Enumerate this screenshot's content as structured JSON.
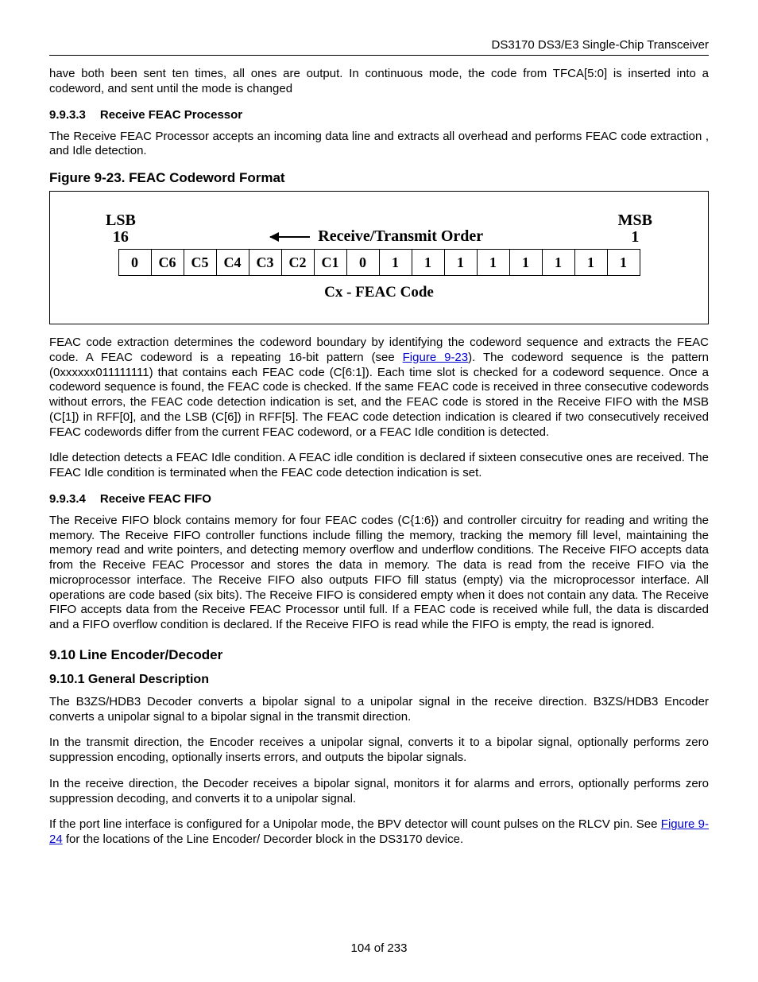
{
  "header": {
    "title": "DS3170 DS3/E3 Single-Chip Transceiver"
  },
  "intro_para": "have both been sent ten times, all ones are output. In continuous mode, the code from TFCA[5:0] is inserted into a codeword, and sent until the mode is changed",
  "sec_9_9_3_3": {
    "num": "9.9.3.3",
    "title": "Receive FEAC Processor",
    "body": "The Receive FEAC Processor accepts an incoming data line and extracts all overhead and performs FEAC code extraction , and Idle detection."
  },
  "figure": {
    "title": "Figure 9-23. FEAC Codeword Format",
    "lsb_label": "LSB",
    "lsb_pos": "16",
    "order_label": "Receive/Transmit Order",
    "msb_label": "MSB",
    "msb_pos": "1",
    "cells": [
      "0",
      "C6",
      "C5",
      "C4",
      "C3",
      "C2",
      "C1",
      "0",
      "1",
      "1",
      "1",
      "1",
      "1",
      "1",
      "1",
      "1"
    ],
    "cx_label": "Cx - FEAC Code"
  },
  "feac_extract_para_pre": "FEAC code extraction determines the codeword boundary by identifying the codeword sequence and extracts the FEAC code. A FEAC codeword is a repeating 16-bit pattern (see ",
  "feac_extract_link": "Figure 9-23",
  "feac_extract_para_post": "). The codeword sequence is the pattern (0xxxxxx011111111) that contains each FEAC code (C[6:1]). Each time slot is checked for a codeword sequence. Once a codeword sequence is found, the FEAC code is checked. If the same FEAC code is received in three consecutive codewords without errors, the FEAC code detection indication is set, and the FEAC code is stored in the Receive FIFO with the MSB (C[1]) in RFF[0], and the LSB (C[6]) in RFF[5]. The FEAC code detection indication is cleared if two consecutively received FEAC codewords differ from the current FEAC codeword, or a FEAC Idle condition is detected.",
  "idle_para": "Idle detection detects a FEAC Idle condition. A FEAC idle condition is declared if sixteen consecutive ones are received. The FEAC Idle condition is terminated when the FEAC code detection indication is set.",
  "sec_9_9_3_4": {
    "num": "9.9.3.4",
    "title": "Receive FEAC FIFO",
    "body": "The Receive FIFO block contains memory for four FEAC codes (C{1:6}) and controller circuitry for reading and writing the memory. The Receive FIFO controller functions include filling the memory, tracking the memory fill level, maintaining the memory read and write pointers, and detecting memory overflow and underflow conditions. The Receive FIFO accepts data from the Receive FEAC Processor and stores the data in memory. The data is read from the receive FIFO via the microprocessor interface. The Receive FIFO also outputs FIFO fill status (empty) via the microprocessor interface. All operations are code based (six bits). The Receive FIFO is considered empty when it does not contain any data. The Receive FIFO accepts data from the Receive FEAC Processor until full. If a FEAC code is received while full, the data is discarded and a FIFO overflow condition is declared. If the Receive FIFO is read while the FIFO is empty, the read is ignored."
  },
  "sec_9_10": {
    "title": "9.10  Line Encoder/Decoder"
  },
  "sec_9_10_1": {
    "title": "9.10.1  General Description",
    "p1": "The B3ZS/HDB3 Decoder converts a bipolar signal to a unipolar signal in the receive direction. B3ZS/HDB3 Encoder converts a unipolar signal to a bipolar signal in the transmit direction.",
    "p2": "In the transmit direction, the Encoder receives a unipolar signal, converts it to a bipolar signal, optionally performs zero suppression encoding, optionally inserts errors, and outputs the bipolar signals.",
    "p3": "In the receive direction, the Decoder receives a bipolar signal, monitors it for alarms and errors, optionally performs zero suppression decoding, and converts it to a unipolar signal.",
    "p4_pre": "If the port line interface is configured for a Unipolar mode, the BPV detector will count pulses on the RLCV pin. See ",
    "p4_link": "Figure 9-24",
    "p4_post": " for the locations of the Line Encoder/ Decorder block in the DS3170 device."
  },
  "footer": "104 of 233"
}
